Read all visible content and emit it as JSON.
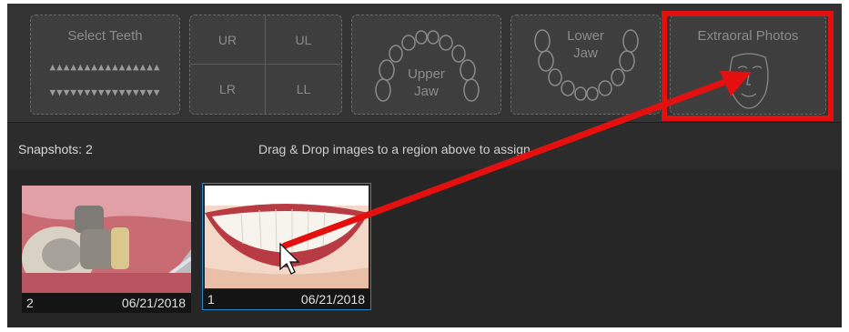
{
  "regions": {
    "select_teeth": {
      "label": "Select Teeth",
      "upper_row": "▲▲▲▲▲▲▲▲▲▲▲▲▲▲▲▲",
      "lower_row": "▼▼▼▼▼▼▼▼▼▼▼▼▼▼▼▼"
    },
    "quadrants": {
      "ur": "UR",
      "ul": "UL",
      "lr": "LR",
      "ll": "LL"
    },
    "upper_jaw": {
      "label_line1": "Upper",
      "label_line2": "Jaw"
    },
    "lower_jaw": {
      "label_line1": "Lower",
      "label_line2": "Jaw"
    },
    "extraoral": {
      "label": "Extraoral Photos"
    }
  },
  "status": {
    "snapshots_label": "Snapshots: 2",
    "hint": "Drag & Drop images to a region above to assign"
  },
  "snapshots": [
    {
      "number": "2",
      "date": "06/21/2018"
    },
    {
      "number": "1",
      "date": "06/21/2018"
    }
  ],
  "colors": {
    "highlight": "#e41010",
    "arrow": "#e41010",
    "selection_border": "#2a86c9"
  }
}
